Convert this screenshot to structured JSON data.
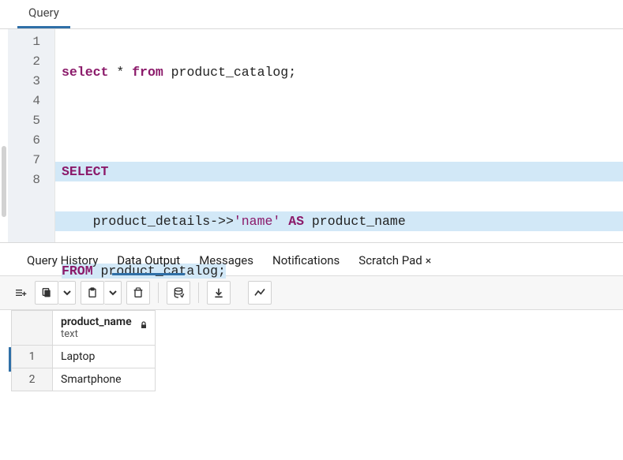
{
  "topTabs": {
    "query": "Query"
  },
  "editor": {
    "lineNumbers": [
      "1",
      "2",
      "3",
      "4",
      "5",
      "6",
      "7",
      "8"
    ],
    "lines": {
      "l1": {
        "kw1": "select",
        "star": "*",
        "kw2": "from",
        "ident": "product_catalog",
        "semi": ";"
      },
      "l3": {
        "kw": "SELECT"
      },
      "l4": {
        "indent": "    ",
        "ident": "product_details",
        "op": "->>",
        "str": "'name'",
        "kw": "AS",
        "alias": "product_name"
      },
      "l5": {
        "kw": "FROM",
        "ident": "product_catalog",
        "semi": ";"
      }
    }
  },
  "resultTabs": {
    "history": "Query History",
    "dataOutput": "Data Output",
    "messages": "Messages",
    "notifications": "Notifications",
    "scratch": "Scratch Pad",
    "close": "×"
  },
  "grid": {
    "column": {
      "name": "product_name",
      "type": "text"
    },
    "rows": [
      {
        "n": "1",
        "v": "Laptop"
      },
      {
        "n": "2",
        "v": "Smartphone"
      }
    ]
  }
}
